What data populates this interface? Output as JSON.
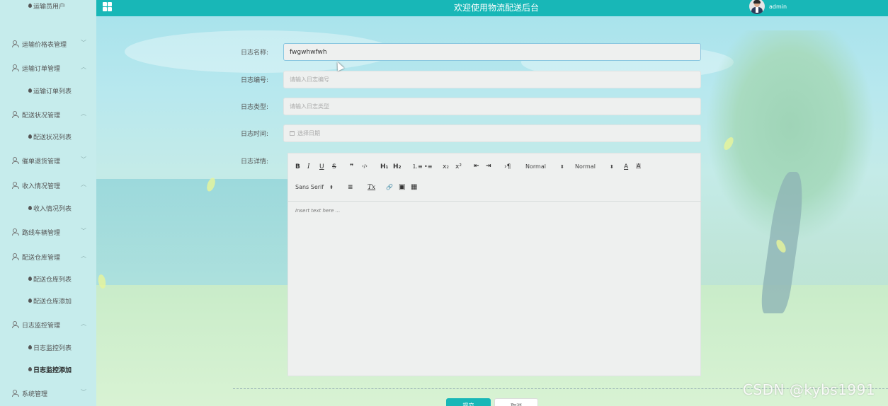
{
  "header": {
    "title": "欢迎使用物流配送后台",
    "username": "admin"
  },
  "sidebar": {
    "items": [
      {
        "label": "运输员用户",
        "level": "sub",
        "chevron": ""
      },
      {
        "label": "运输价格表管理",
        "level": "group",
        "chevron": "﹀"
      },
      {
        "label": "运输订单管理",
        "level": "group",
        "chevron": "︿"
      },
      {
        "label": "运输订单列表",
        "level": "sub",
        "chevron": ""
      },
      {
        "label": "配送状况管理",
        "level": "group",
        "chevron": "︿"
      },
      {
        "label": "配送状况列表",
        "level": "sub",
        "chevron": ""
      },
      {
        "label": "催单退货管理",
        "level": "group",
        "chevron": "﹀"
      },
      {
        "label": "收入情况管理",
        "level": "group",
        "chevron": "︿"
      },
      {
        "label": "收入情况列表",
        "level": "sub",
        "chevron": ""
      },
      {
        "label": "路线车辆管理",
        "level": "group",
        "chevron": "﹀"
      },
      {
        "label": "配送仓库管理",
        "level": "group",
        "chevron": "︿"
      },
      {
        "label": "配送仓库列表",
        "level": "sub",
        "chevron": ""
      },
      {
        "label": "配送仓库添加",
        "level": "sub",
        "chevron": ""
      },
      {
        "label": "日志监控管理",
        "level": "group",
        "chevron": "︿"
      },
      {
        "label": "日志监控列表",
        "level": "sub",
        "chevron": ""
      },
      {
        "label": "日志监控添加",
        "level": "sub",
        "chevron": "",
        "active": true
      },
      {
        "label": "系统管理",
        "level": "group",
        "chevron": "﹀"
      }
    ]
  },
  "form": {
    "name_label": "日志名称:",
    "name_value": "fwgwhwfwh",
    "code_label": "日志编号:",
    "code_placeholder": "请输入日志编号",
    "type_label": "日志类型:",
    "type_placeholder": "请输入日志类型",
    "time_label": "日志时间:",
    "time_placeholder": "选择日期",
    "detail_label": "日志详情:",
    "editor_placeholder": "Insert text here ...",
    "submit_label": "提交",
    "cancel_label": "取消"
  },
  "toolbar": {
    "bold": "B",
    "italic": "I",
    "underline": "U",
    "strike": "S",
    "quote": "❞",
    "code": "‹/›",
    "h1": "H₁",
    "h2": "H₂",
    "ordered_list": "⒈≡",
    "bullet_list": "•≡",
    "subscript": "x₂",
    "superscript": "x²",
    "outdent": "⇤",
    "indent": "⇥",
    "direction": "›¶",
    "size_select": "Normal",
    "header_select": "Normal",
    "font_color": "A",
    "background": "A",
    "font_select": "Sans Serif",
    "align": "≡",
    "clean": "Tx",
    "link": "🔗",
    "image": "▣",
    "video": "▦"
  },
  "watermark": "CSDN @kybs1991"
}
